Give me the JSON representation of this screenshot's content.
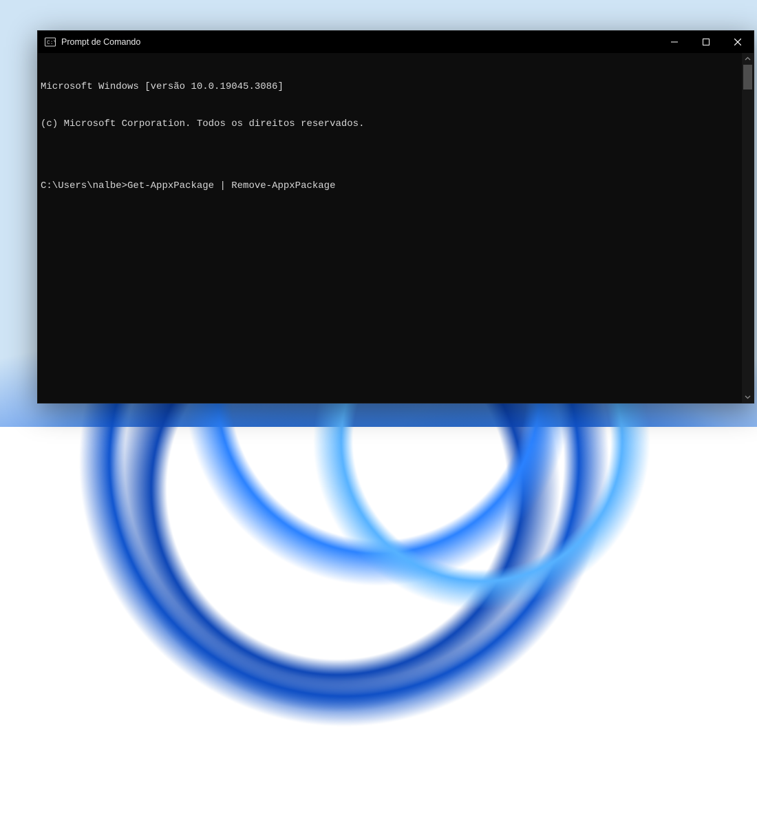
{
  "window": {
    "title": "Prompt de Comando"
  },
  "terminal": {
    "lines": [
      "Microsoft Windows [versão 10.0.19045.3086]",
      "(c) Microsoft Corporation. Todos os direitos reservados.",
      "",
      ""
    ],
    "prompt": "C:\\Users\\nalbe>",
    "command": "Get-AppxPackage | Remove-AppxPackage"
  }
}
